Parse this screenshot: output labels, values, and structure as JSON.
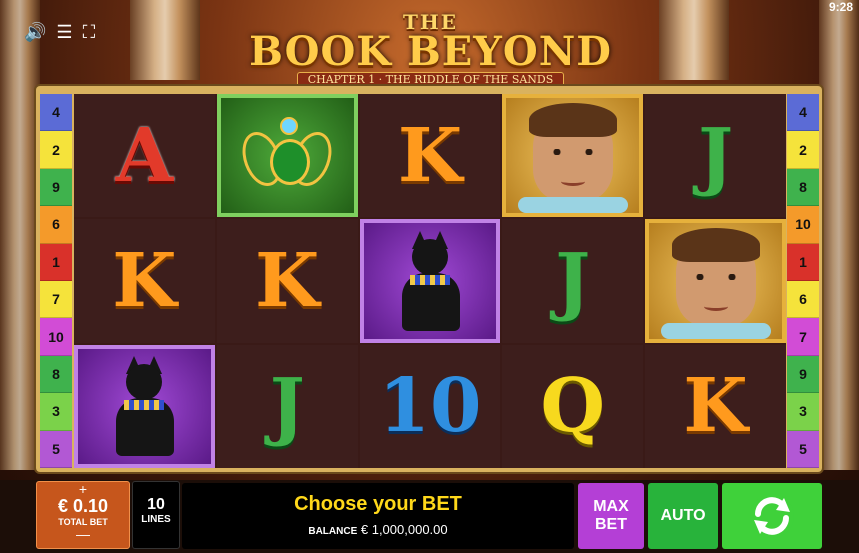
{
  "status": {
    "time": "9:28"
  },
  "game": {
    "title_the": "THE",
    "title_main": "BOOK BEYOND",
    "subtitle": "CHAPTER 1 · THE RIDDLE OF THE SANDS"
  },
  "reels": [
    {
      "symbols": [
        "A",
        "K",
        "cat"
      ]
    },
    {
      "symbols": [
        "scarab",
        "K",
        "J"
      ]
    },
    {
      "symbols": [
        "K",
        "cat",
        "10"
      ]
    },
    {
      "symbols": [
        "explorer",
        "J",
        "Q"
      ]
    },
    {
      "symbols": [
        "J",
        "explorer",
        "K"
      ]
    }
  ],
  "paylines": {
    "left": [
      "4",
      "2",
      "9",
      "6",
      "1",
      "7",
      "10",
      "8",
      "3",
      "5"
    ],
    "right": [
      "4",
      "2",
      "8",
      "10",
      "1",
      "6",
      "7",
      "9",
      "3",
      "5"
    ]
  },
  "hud": {
    "plus": "+",
    "bet_value": "€ 0.10",
    "bet_label": "TOTAL BET",
    "minus": "—",
    "lines_value": "10",
    "lines_label": "LINES",
    "message": "Choose your BET",
    "balance_label": "BALANCE",
    "balance_value": "€ 1,000,000.00",
    "max_bet": "MAX BET",
    "auto": "AUTO"
  },
  "colors": {
    "line_colors": [
      "#5b6bd6",
      "#f5e33b",
      "#3fb24d",
      "#f49a2a",
      "#d9312a",
      "#f5e33b",
      "#d24cd6",
      "#3fb24d",
      "#7bd24a",
      "#b258d4"
    ]
  }
}
